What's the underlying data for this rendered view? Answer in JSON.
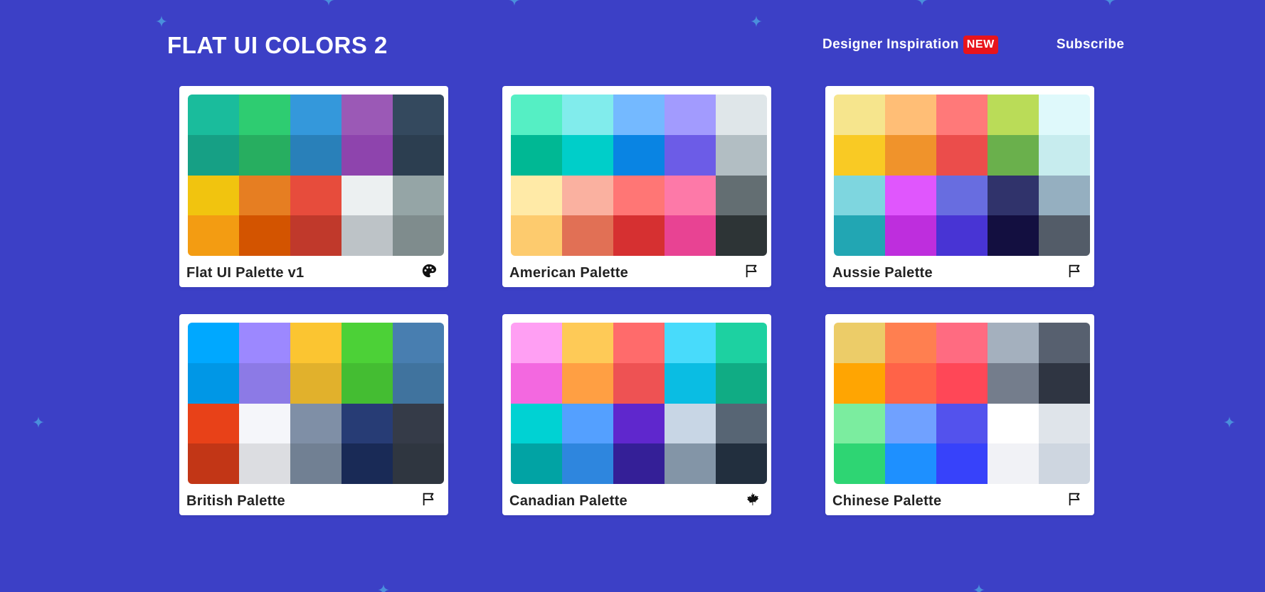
{
  "header": {
    "logo": "FLAT UI COLORS 2",
    "nav": {
      "inspiration_label": "Designer Inspiration",
      "new_badge": "NEW",
      "subscribe_label": "Subscribe"
    }
  },
  "colors": {
    "background": "#3c40c6",
    "sparkle": "#4a8fdc",
    "badge": "#e8141b"
  },
  "palettes": [
    {
      "name": "Flat UI Palette v1",
      "icon": "palette-icon",
      "colors": [
        "#1abc9c",
        "#2ecc71",
        "#3498db",
        "#9b59b6",
        "#34495e",
        "#16a085",
        "#27ae60",
        "#2980b9",
        "#8e44ad",
        "#2c3e50",
        "#f1c40f",
        "#e67e22",
        "#e74c3c",
        "#ecf0f1",
        "#95a5a6",
        "#f39c12",
        "#d35400",
        "#c0392b",
        "#bdc3c7",
        "#7f8c8d"
      ]
    },
    {
      "name": "American Palette",
      "icon": "flag-icon",
      "colors": [
        "#55efc4",
        "#81ecec",
        "#74b9ff",
        "#a29bfe",
        "#dfe6e9",
        "#00b894",
        "#00cec9",
        "#0984e3",
        "#6c5ce7",
        "#b2bec3",
        "#ffeaa7",
        "#fab1a0",
        "#ff7675",
        "#fd79a8",
        "#636e72",
        "#fdcb6e",
        "#e17055",
        "#d63031",
        "#e84393",
        "#2d3436"
      ]
    },
    {
      "name": "Aussie Palette",
      "icon": "flag-icon",
      "colors": [
        "#f6e58d",
        "#ffbe76",
        "#ff7979",
        "#badc58",
        "#dff9fb",
        "#f9ca24",
        "#f0932b",
        "#eb4d4b",
        "#6ab04c",
        "#c7ecee",
        "#7ed6df",
        "#e056fd",
        "#686de0",
        "#30336b",
        "#95afc0",
        "#22a6b3",
        "#be2edd",
        "#4834d4",
        "#130f40",
        "#535c68"
      ]
    },
    {
      "name": "British Palette",
      "icon": "flag-icon",
      "colors": [
        "#00a8ff",
        "#9c88ff",
        "#fbc531",
        "#4cd137",
        "#487eb0",
        "#0097e6",
        "#8c7ae6",
        "#e1b12c",
        "#44bd32",
        "#40739e",
        "#e84118",
        "#f5f6fa",
        "#7f8fa6",
        "#273c75",
        "#353b48",
        "#c23616",
        "#dcdde1",
        "#718093",
        "#192a56",
        "#2f3640"
      ]
    },
    {
      "name": "Canadian Palette",
      "icon": "maple-leaf-icon",
      "colors": [
        "#ff9ff3",
        "#feca57",
        "#ff6b6b",
        "#48dbfb",
        "#1dd1a1",
        "#f368e0",
        "#ff9f43",
        "#ee5253",
        "#0abde3",
        "#10ac84",
        "#00d2d3",
        "#54a0ff",
        "#5f27cd",
        "#c8d6e5",
        "#576574",
        "#01a3a4",
        "#2e86de",
        "#341f97",
        "#8395a7",
        "#222f3e"
      ]
    },
    {
      "name": "Chinese Palette",
      "icon": "flag-icon",
      "colors": [
        "#eccc68",
        "#ff7f50",
        "#ff6b81",
        "#a4b0be",
        "#57606f",
        "#ffa502",
        "#ff6348",
        "#ff4757",
        "#747d8c",
        "#2f3542",
        "#7bed9f",
        "#70a1ff",
        "#5352ed",
        "#ffffff",
        "#dfe4ea",
        "#2ed573",
        "#1e90ff",
        "#3742fa",
        "#f1f2f6",
        "#ced6e0"
      ]
    }
  ]
}
